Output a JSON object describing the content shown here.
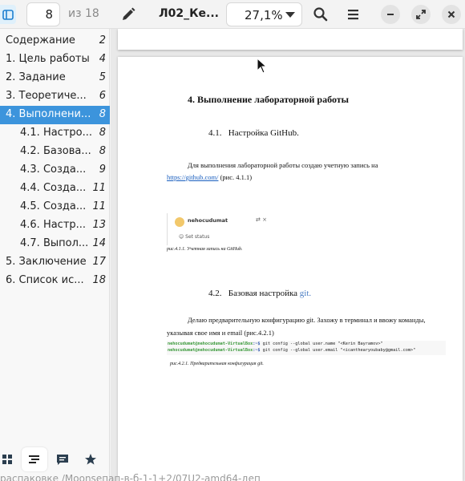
{
  "header": {
    "page_number": "8",
    "page_total": "из 18",
    "title": "Л02_Ке...",
    "zoom": "27,1%"
  },
  "sidebar": {
    "items": [
      {
        "label": "Содержание",
        "page": "2"
      },
      {
        "label": "1. Цель работы",
        "page": "4"
      },
      {
        "label": "2. Задание",
        "page": "5"
      },
      {
        "label": "3. Теоретиче...",
        "page": "6"
      },
      {
        "label": "4. Выполнени...",
        "page": "8",
        "active": true
      },
      {
        "label": "4.1. Настро...",
        "page": "8"
      },
      {
        "label": "4.2. Базова...",
        "page": "8"
      },
      {
        "label": "4.3. Созда...",
        "page": "9"
      },
      {
        "label": "4.4. Созда...",
        "page": "11"
      },
      {
        "label": "4.5. Созда...",
        "page": "11"
      },
      {
        "label": "4.6. Настр...",
        "page": "13"
      },
      {
        "label": "4.7. Выпол...",
        "page": "14"
      },
      {
        "label": "5. Заключение",
        "page": "17"
      },
      {
        "label": "6. Список ис...",
        "page": "18"
      }
    ],
    "tabs": [
      "thumbnails",
      "outline",
      "annotations",
      "bookmarks"
    ]
  },
  "document": {
    "section_heading": "4. Выполнение лабораторной работы",
    "sub1_num": "4.1.",
    "sub1_title": "Настройка GitHub.",
    "para1_text": "Для выполнения лабораторной работы создаю учетную запись на",
    "para1_link": "https://github.com/",
    "para1_tail": " (рис. 4.1.1)",
    "shot_username": "nehocudumat",
    "shot_icons": "⇄ ×",
    "shot_status": "☺ Set status",
    "caption1": "рис.4.1.1. Учетная запись на GitHub.",
    "sub2_num": "4.2.",
    "sub2_title": "Базовая настройка ",
    "sub2_git": "git.",
    "para2_text": "Делаю предварительную конфигурацию git. Захожу в терминал и ввожу команды, указывая свое имя и email (рис.4.2.1)",
    "term_line1_user": "nehocudumat@nehocudumat-VirtualBox",
    "term_line1_dir": ":~$",
    "term_line1_cmd": " git config --global user.name \"<Kerin Bayramov>\"",
    "term_line2_user": "nehocudumat@nehocudumat-VirtualBox",
    "term_line2_dir": ":~$",
    "term_line2_cmd": " git config --global user.email \"<icanthearyoubaby@gmail.com>\"",
    "caption2": "рис.4.2.1. Предварительная конфигурация git."
  },
  "bleed_text": "распаковке  /Moonsепап-в-б-1-1+2/07U2-аmd64-деп",
  "colors": {
    "accent": "#3c94dc",
    "toggle_bg": "#dff0fb",
    "link": "#1a5fbf"
  }
}
